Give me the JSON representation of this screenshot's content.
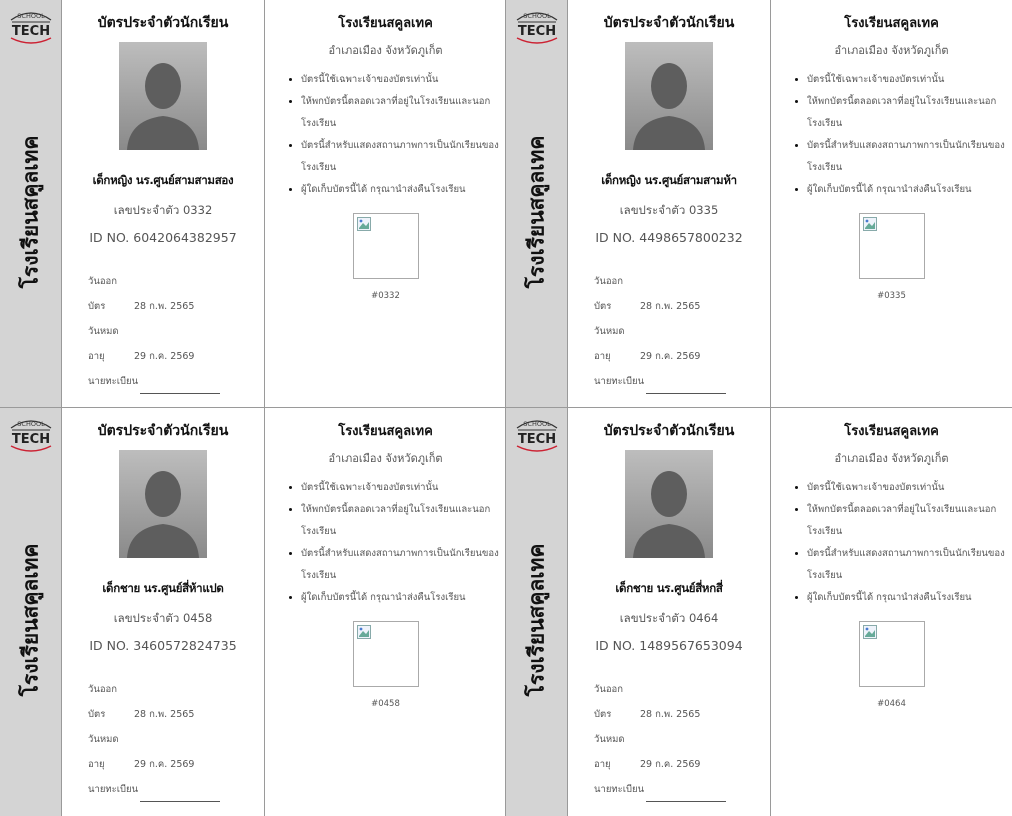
{
  "logo": {
    "top": "SCHOOL",
    "main": "TECH"
  },
  "cards": [
    {
      "side_text": "โรงเรียนสคูลเทค",
      "title": "บัตรประจำตัวนักเรียน",
      "name": "เด็กหญิง นร.ศูนย์สามสามสอง",
      "card_number": "เลขประจำตัว 0332",
      "id_no": "ID NO. 6042064382957",
      "issue_label": "วันออกบัตร",
      "issue_date": "28 ก.พ. 2565",
      "expiry_label": "วันหมดอายุ",
      "expiry_date": "29 ก.ค. 2569",
      "registrar_label": "นายทะเบียน",
      "school": "โรงเรียนสคูลเทค",
      "location": "อำเภอเมือง จังหวัดภูเก็ต",
      "rules": [
        "บัตรนี้ใช้เฉพาะเจ้าของบัตรเท่านั้น",
        "ให้พกบัตรนี้ตลอดเวลาที่อยู่ในโรงเรียนและนอกโรงเรียน",
        "บัตรนี้สำหรับแสดงสถานภาพการเป็นนักเรียนของโรงเรียน",
        "ผู้ใดเก็บบัตรนี้ได้ กรุณานำส่งคืนโรงเรียน"
      ],
      "code": "#0332"
    },
    {
      "side_text": "โรงเรียนสคูลเทค",
      "title": "บัตรประจำตัวนักเรียน",
      "name": "เด็กหญิง นร.ศูนย์สามสามห้า",
      "card_number": "เลขประจำตัว 0335",
      "id_no": "ID NO. 4498657800232",
      "issue_label": "วันออกบัตร",
      "issue_date": "28 ก.พ. 2565",
      "expiry_label": "วันหมดอายุ",
      "expiry_date": "29 ก.ค. 2569",
      "registrar_label": "นายทะเบียน",
      "school": "โรงเรียนสคูลเทค",
      "location": "อำเภอเมือง จังหวัดภูเก็ต",
      "rules": [
        "บัตรนี้ใช้เฉพาะเจ้าของบัตรเท่านั้น",
        "ให้พกบัตรนี้ตลอดเวลาที่อยู่ในโรงเรียนและนอกโรงเรียน",
        "บัตรนี้สำหรับแสดงสถานภาพการเป็นนักเรียนของโรงเรียน",
        "ผู้ใดเก็บบัตรนี้ได้ กรุณานำส่งคืนโรงเรียน"
      ],
      "code": "#0335"
    },
    {
      "side_text": "โรงเรียนสคูลเทค",
      "title": "บัตรประจำตัวนักเรียน",
      "name": "เด็กชาย นร.ศูนย์สี่ห้าแปด",
      "card_number": "เลขประจำตัว 0458",
      "id_no": "ID NO. 3460572824735",
      "issue_label": "วันออกบัตร",
      "issue_date": "28 ก.พ. 2565",
      "expiry_label": "วันหมดอายุ",
      "expiry_date": "29 ก.ค. 2569",
      "registrar_label": "นายทะเบียน",
      "school": "โรงเรียนสคูลเทค",
      "location": "อำเภอเมือง จังหวัดภูเก็ต",
      "rules": [
        "บัตรนี้ใช้เฉพาะเจ้าของบัตรเท่านั้น",
        "ให้พกบัตรนี้ตลอดเวลาที่อยู่ในโรงเรียนและนอกโรงเรียน",
        "บัตรนี้สำหรับแสดงสถานภาพการเป็นนักเรียนของโรงเรียน",
        "ผู้ใดเก็บบัตรนี้ได้ กรุณานำส่งคืนโรงเรียน"
      ],
      "code": "#0458"
    },
    {
      "side_text": "โรงเรียนสคูลเทค",
      "title": "บัตรประจำตัวนักเรียน",
      "name": "เด็กชาย นร.ศูนย์สี่หกสี่",
      "card_number": "เลขประจำตัว 0464",
      "id_no": "ID NO. 1489567653094",
      "issue_label": "วันออกบัตร",
      "issue_date": "28 ก.พ. 2565",
      "expiry_label": "วันหมดอายุ",
      "expiry_date": "29 ก.ค. 2569",
      "registrar_label": "นายทะเบียน",
      "school": "โรงเรียนสคูลเทค",
      "location": "อำเภอเมือง จังหวัดภูเก็ต",
      "rules": [
        "บัตรนี้ใช้เฉพาะเจ้าของบัตรเท่านั้น",
        "ให้พกบัตรนี้ตลอดเวลาที่อยู่ในโรงเรียนและนอกโรงเรียน",
        "บัตรนี้สำหรับแสดงสถานภาพการเป็นนักเรียนของโรงเรียน",
        "ผู้ใดเก็บบัตรนี้ได้ กรุณานำส่งคืนโรงเรียน"
      ],
      "code": "#0464"
    }
  ]
}
